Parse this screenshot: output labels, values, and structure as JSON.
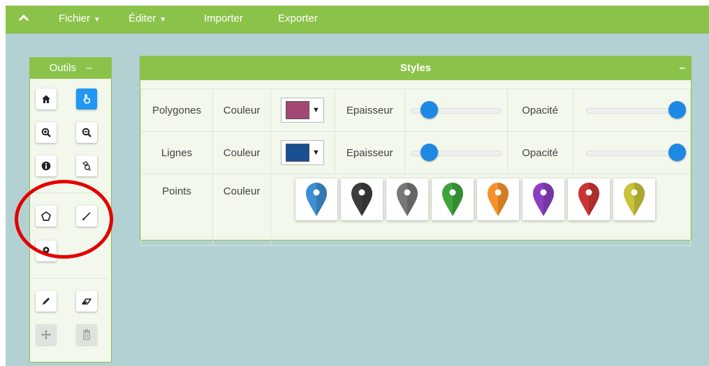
{
  "menu": {
    "collapse_icon": "chevron-up-icon",
    "items": [
      {
        "label": "Fichier",
        "has_dropdown": true
      },
      {
        "label": "Éditer",
        "has_dropdown": true
      },
      {
        "label": "Importer",
        "has_dropdown": false
      },
      {
        "label": "Exporter",
        "has_dropdown": false
      }
    ]
  },
  "tools_panel": {
    "title": "Outils",
    "minimize_symbol": "–",
    "buttons": [
      {
        "icon": "home-icon",
        "state": "normal"
      },
      {
        "icon": "pointer-hand-icon",
        "state": "active"
      },
      {
        "icon": "zoom-in-icon",
        "state": "normal"
      },
      {
        "icon": "zoom-out-icon",
        "state": "normal"
      },
      {
        "icon": "info-icon",
        "state": "normal"
      },
      {
        "icon": "query-icon",
        "state": "normal"
      },
      {
        "icon": "draw-polygon-icon",
        "state": "normal"
      },
      {
        "icon": "draw-line-icon",
        "state": "normal"
      },
      {
        "icon": "draw-point-icon",
        "state": "normal"
      },
      {
        "icon": "pencil-icon",
        "state": "normal"
      },
      {
        "icon": "eraser-icon",
        "state": "normal"
      },
      {
        "icon": "move-icon",
        "state": "disabled"
      },
      {
        "icon": "trash-icon",
        "state": "disabled"
      }
    ]
  },
  "styles_panel": {
    "title": "Styles",
    "minimize_symbol": "–",
    "rows": [
      {
        "name": "Polygones",
        "color_label": "Couleur",
        "color": "#a34774",
        "thickness_label": "Epaisseur",
        "thickness": 0.2,
        "opacity_label": "Opacité",
        "opacity": 1.0
      },
      {
        "name": "Lignes",
        "color_label": "Couleur",
        "color": "#1a4f91",
        "thickness_label": "Epaisseur",
        "thickness": 0.2,
        "opacity_label": "Opacité",
        "opacity": 1.0
      }
    ],
    "points": {
      "name": "Points",
      "color_label": "Couleur",
      "marker_colors": [
        "#3d8fd3",
        "#3d3d3d",
        "#777777",
        "#3ea43a",
        "#f7922a",
        "#8a3fc1",
        "#c93534",
        "#c7c33a"
      ]
    }
  },
  "colors": {
    "accent": "#8bc34a",
    "map_background": "#b3d0d3",
    "slider_knob": "#1e88e5",
    "highlight": "#e30000"
  }
}
